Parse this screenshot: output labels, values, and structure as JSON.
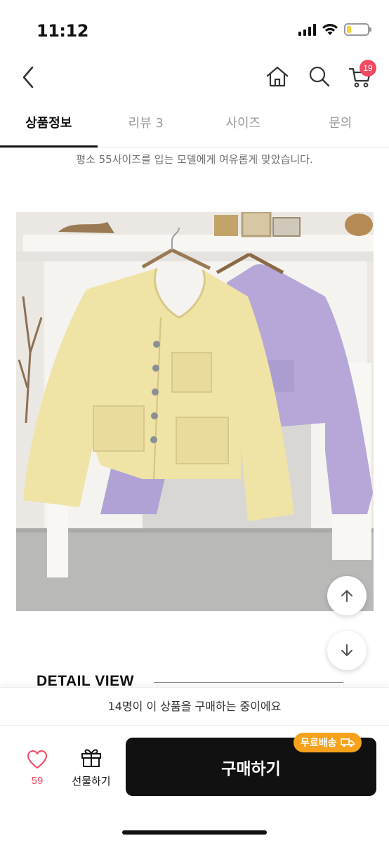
{
  "status_bar": {
    "time": "11:12"
  },
  "header": {
    "cart_count": "19"
  },
  "tabs": [
    {
      "label": "상품정보",
      "active": true
    },
    {
      "label": "리뷰 3",
      "active": false
    },
    {
      "label": "사이즈",
      "active": false
    },
    {
      "label": "문의",
      "active": false
    }
  ],
  "product": {
    "size_note": "평소 55사이즈를 입는 모델에게 여유롭게 맞았습니다.",
    "section_title": "DETAIL VIEW"
  },
  "viewers_text": "14명이 이 상품을 구매하는 중이에요",
  "bottom_bar": {
    "like_count": "59",
    "gift_label": "선물하기",
    "buy_label": "구매하기",
    "shipping_badge": "무료배송"
  },
  "colors": {
    "accent": "#f04a64",
    "shipping_badge": "#f7a21b",
    "buy_button": "#111111"
  }
}
